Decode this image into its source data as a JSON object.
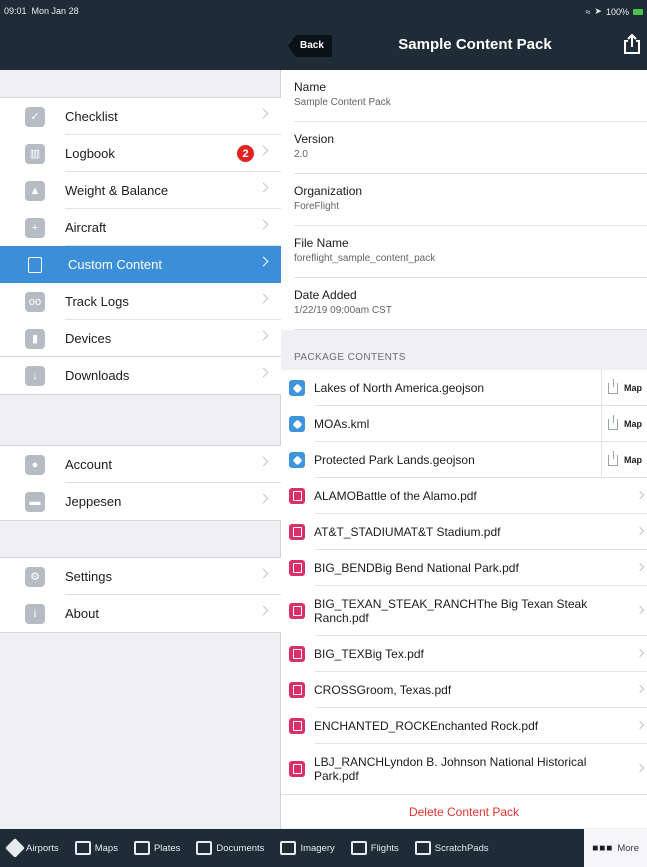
{
  "status": {
    "time": "09:01",
    "date": "Mon Jan 28",
    "battery": "100%"
  },
  "nav": {
    "back_label": "Back",
    "title": "Sample Content Pack"
  },
  "sidebar": {
    "groups": [
      [
        {
          "label": "Checklist",
          "icon": "checkmark-icon"
        },
        {
          "label": "Logbook",
          "icon": "book-icon",
          "badge": "2"
        },
        {
          "label": "Weight & Balance",
          "icon": "scale-icon"
        },
        {
          "label": "Aircraft",
          "icon": "plane-icon"
        },
        {
          "label": "Custom Content",
          "icon": "document-icon",
          "active": true
        },
        {
          "label": "Track Logs",
          "icon": "tape-icon"
        },
        {
          "label": "Devices",
          "icon": "plug-icon"
        }
      ],
      [
        {
          "label": "Downloads",
          "icon": "download-icon"
        }
      ],
      [
        {
          "label": "Account",
          "icon": "person-icon"
        },
        {
          "label": "Jeppesen",
          "icon": "jeppesen-icon"
        }
      ],
      [
        {
          "label": "Settings",
          "icon": "gear-icon"
        },
        {
          "label": "About",
          "icon": "info-icon"
        }
      ]
    ]
  },
  "detail": {
    "properties": [
      {
        "key": "Name",
        "value": "Sample Content Pack"
      },
      {
        "key": "Version",
        "value": "2.0"
      },
      {
        "key": "Organization",
        "value": "ForeFlight"
      },
      {
        "key": "File Name",
        "value": "foreflight_sample_content_pack"
      },
      {
        "key": "Date Added",
        "value": "1/22/19 09:00am CST"
      }
    ],
    "section_header": "PACKAGE CONTENTS",
    "map_label": "Map",
    "items": [
      {
        "name": "Lakes of North America.geojson",
        "type": "geo"
      },
      {
        "name": "MOAs.kml",
        "type": "geo"
      },
      {
        "name": "Protected Park Lands.geojson",
        "type": "geo"
      },
      {
        "name": "ALAMOBattle of the Alamo.pdf",
        "type": "pdf"
      },
      {
        "name": "AT&T_STADIUMAT&T Stadium.pdf",
        "type": "pdf"
      },
      {
        "name": "BIG_BENDBig Bend National Park.pdf",
        "type": "pdf"
      },
      {
        "name": "BIG_TEXAN_STEAK_RANCHThe Big Texan Steak Ranch.pdf",
        "type": "pdf",
        "tall": true
      },
      {
        "name": "BIG_TEXBig Tex.pdf",
        "type": "pdf"
      },
      {
        "name": "CROSSGroom, Texas.pdf",
        "type": "pdf"
      },
      {
        "name": "ENCHANTED_ROCKEnchanted Rock.pdf",
        "type": "pdf"
      },
      {
        "name": "LBJ_RANCHLyndon B. Johnson National Historical Park.pdf",
        "type": "pdf",
        "tall": true
      }
    ],
    "delete_label": "Delete Content Pack"
  },
  "tabs": [
    {
      "label": "Airports",
      "icon": "airports-icon"
    },
    {
      "label": "Maps",
      "icon": "maps-icon"
    },
    {
      "label": "Plates",
      "icon": "plates-icon"
    },
    {
      "label": "Documents",
      "icon": "documents-icon"
    },
    {
      "label": "Imagery",
      "icon": "imagery-icon"
    },
    {
      "label": "Flights",
      "icon": "flights-icon"
    },
    {
      "label": "ScratchPads",
      "icon": "scratchpads-icon"
    },
    {
      "label": "More",
      "icon": "more-icon",
      "selected": true
    }
  ],
  "colors": {
    "nav_bg": "#1f2b36",
    "accent": "#3a8fd8",
    "badge": "#e02424",
    "delete": "#e0332d",
    "pdf_icon": "#db2f6b",
    "geo_icon": "#3f95dc"
  }
}
